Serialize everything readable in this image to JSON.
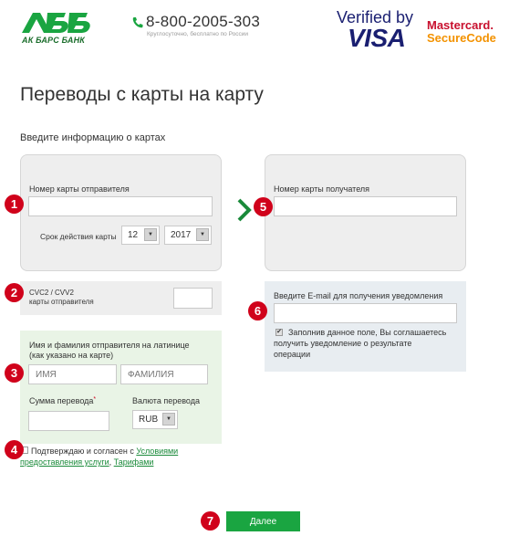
{
  "header": {
    "logo_text": "АК БАРС БАНК",
    "phone": "8-800-2005-303",
    "phone_note": "Круглосуточно, бесплатно по России",
    "verified_by": "Verified by",
    "visa": "VISA",
    "mastercard": "Mastercard.",
    "securecode": "SecureCode"
  },
  "page": {
    "title": "Переводы с карты на карту",
    "subtitle": "Введите информацию о картах"
  },
  "sender": {
    "card_label": "Номер карты отправителя",
    "card_value": "",
    "expiry_label": "Срок действия карты",
    "month": "12",
    "year": "2017"
  },
  "cvc": {
    "label_line1": "CVC2 / CVV2",
    "label_line2": "карты отправителя",
    "value": ""
  },
  "recipient": {
    "card_label": "Номер карты получателя",
    "card_value": ""
  },
  "email": {
    "label": "Введите E-mail для получения уведомления",
    "value": "",
    "checkbox_text_1": "Заполнив данное поле, Вы соглашаетесь",
    "checkbox_text_2": "получить уведомление о результате",
    "checkbox_text_3": "операции"
  },
  "name": {
    "label_line1": "Имя и фамилия отправителя на латинице",
    "label_line2": "(как указано на карте)",
    "first_placeholder": "ИМЯ",
    "last_placeholder": "ФАМИЛИЯ",
    "amount_label": "Сумма перевода",
    "amount_required": "*",
    "currency_label": "Валюта перевода",
    "currency": "RUB"
  },
  "agreement": {
    "text": "Подтверждаю и согласен с",
    "link1_part1": "Условиями",
    "link1_part2": "предоставления услуги",
    "comma": ",",
    "link2": "Тарифами"
  },
  "submit": {
    "label": "Далее"
  },
  "badges": [
    "1",
    "2",
    "3",
    "4",
    "5",
    "6",
    "7"
  ],
  "colors": {
    "accent": "#1aa541",
    "badge": "#d0021b",
    "brand_green": "#1a6d2b"
  }
}
